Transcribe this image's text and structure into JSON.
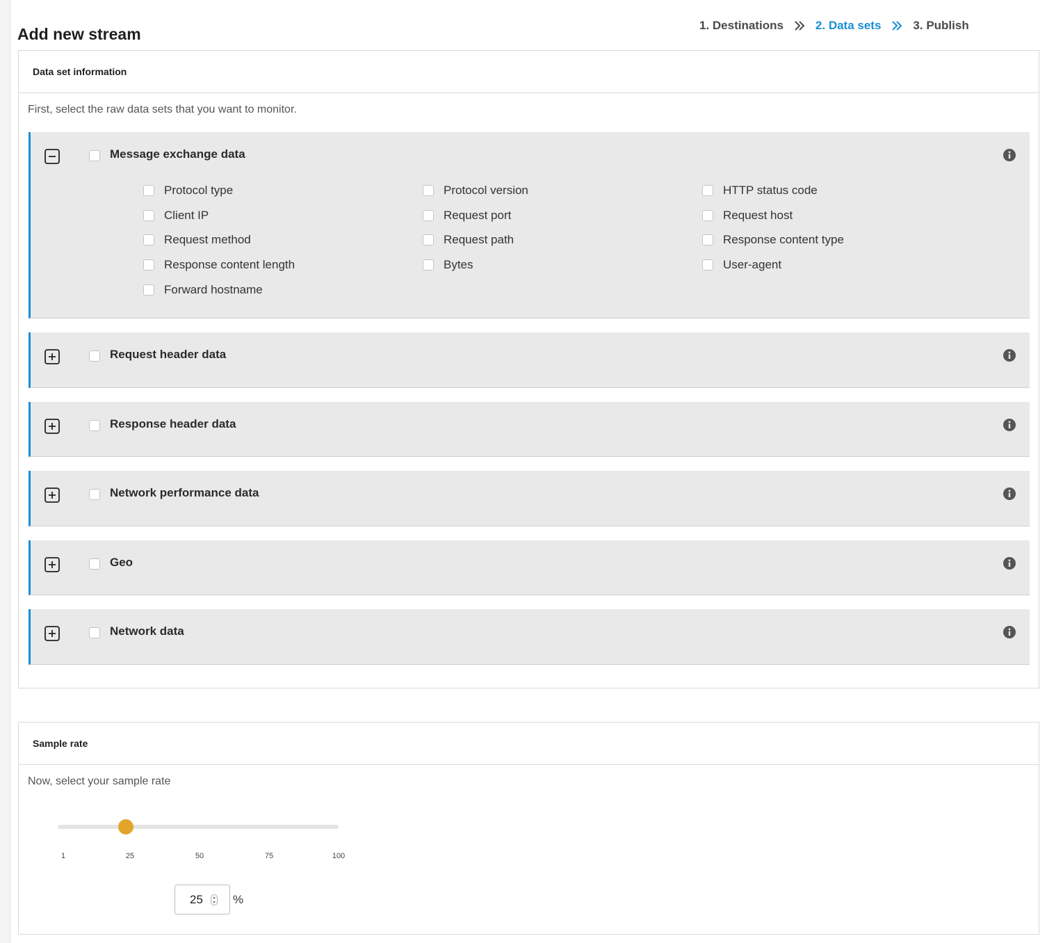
{
  "page": {
    "title": "Add new stream"
  },
  "wizard": {
    "steps": [
      {
        "label": "1. Destinations",
        "active": false
      },
      {
        "label": "2. Data sets",
        "active": true
      },
      {
        "label": "3. Publish",
        "active": false
      }
    ]
  },
  "data_sets": {
    "heading": "Data set information",
    "intro": "First, select the raw data sets that you want to monitor.",
    "groups": [
      {
        "label": "Message exchange data",
        "expanded": true,
        "checked": false,
        "fields": [
          {
            "label": "Protocol type",
            "checked": false
          },
          {
            "label": "Protocol version",
            "checked": false
          },
          {
            "label": "HTTP status code",
            "checked": false
          },
          {
            "label": "Client IP",
            "checked": false
          },
          {
            "label": "Request port",
            "checked": false
          },
          {
            "label": "Request host",
            "checked": false
          },
          {
            "label": "Request method",
            "checked": false
          },
          {
            "label": "Request path",
            "checked": false
          },
          {
            "label": "Response content type",
            "checked": false
          },
          {
            "label": "Response content length",
            "checked": false
          },
          {
            "label": "Bytes",
            "checked": false
          },
          {
            "label": "User-agent",
            "checked": false
          },
          {
            "label": "Forward hostname",
            "checked": false
          }
        ]
      },
      {
        "label": "Request header data",
        "expanded": false,
        "checked": false
      },
      {
        "label": "Response header data",
        "expanded": false,
        "checked": false
      },
      {
        "label": "Network performance data",
        "expanded": false,
        "checked": false
      },
      {
        "label": "Geo",
        "expanded": false,
        "checked": false
      },
      {
        "label": "Network data",
        "expanded": false,
        "checked": false
      }
    ]
  },
  "sample_rate": {
    "heading": "Sample rate",
    "intro": "Now, select your sample rate",
    "min": 1,
    "max": 100,
    "value": 25,
    "value_text": "25",
    "unit": "%",
    "ticks": [
      "1",
      "25",
      "50",
      "75",
      "100"
    ]
  },
  "colors": {
    "accent": "#1a8fd6",
    "slider_thumb": "#e2a52c",
    "group_bg": "#e9e9e9"
  },
  "icons": {
    "wizard_separator": "double-chevron-right-icon",
    "collapse": "minus-square-icon",
    "expand": "plus-square-icon",
    "info": "info-circle-icon"
  }
}
